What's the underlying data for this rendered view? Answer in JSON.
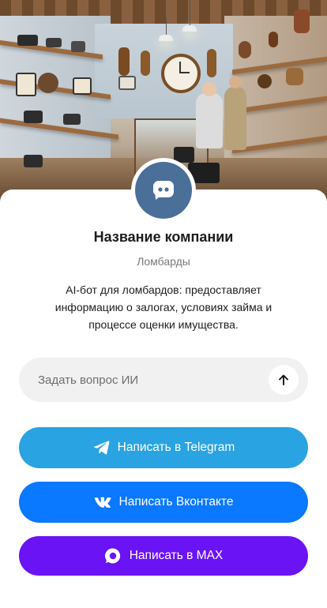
{
  "company": {
    "name": "Название компании",
    "category": "Ломбарды",
    "description": "AI-бот для ломбардов: предоставляет информацию о залогах, условиях займа и процессе оценки имущества."
  },
  "ask": {
    "placeholder": "Задать вопрос ИИ",
    "value": "",
    "send_icon": "arrow-up-icon"
  },
  "actions": [
    {
      "label": "Написать в Telegram",
      "icon": "telegram-icon",
      "color": "#2AA3E3"
    },
    {
      "label": "Написать Вконтакте",
      "icon": "vk-icon",
      "color": "#0A78FF"
    },
    {
      "label": "Написать в MAX",
      "icon": "max-icon",
      "color": "#6A13F5"
    }
  ],
  "avatar": {
    "icon": "chat-bubble-icon",
    "color": "#4A6F98"
  },
  "hero": {
    "image": "pawn-shop-interior-illustration"
  }
}
